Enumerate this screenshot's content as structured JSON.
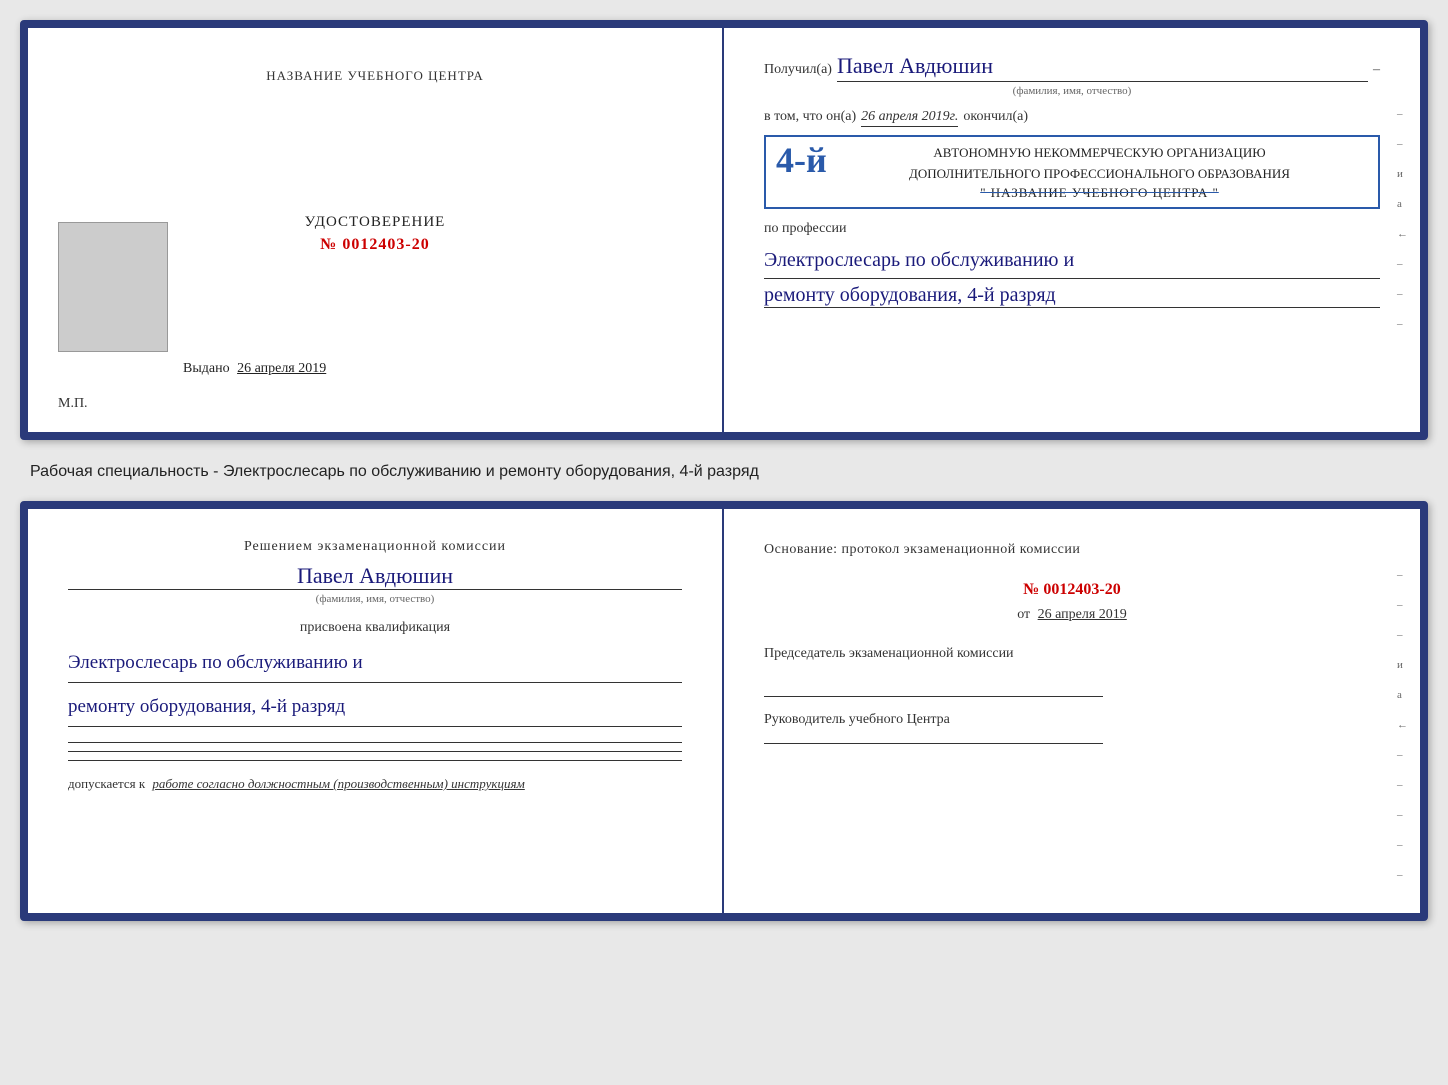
{
  "top_left": {
    "title": "НАЗВАНИЕ УЧЕБНОГО ЦЕНТРА",
    "udostoverenie_label": "УДОСТОВЕРЕНИЕ",
    "number": "№ 0012403-20",
    "vydano_label": "Выдано",
    "vydano_date": "26 апреля 2019",
    "mp_label": "М.П."
  },
  "top_right": {
    "poluchil_label": "Получил(а)",
    "name": "Павел Авдюшин",
    "name_hint": "(фамилия, имя, отчество)",
    "v_tom_label": "в том, что он(а)",
    "date": "26 апреля 2019г.",
    "okончil_label": "окончил(а)",
    "razryad_big": "4-й",
    "org_line1": "АВТОНОМНУЮ НЕКОММЕРЧЕСКУЮ ОРГАНИЗАЦИЮ",
    "org_line2": "ДОПОЛНИТЕЛЬНОГО ПРОФЕССИОНАЛЬНОГО ОБРАЗОВАНИЯ",
    "org_name": "\" НАЗВАНИЕ УЧЕБНОГО ЦЕНТРА \"",
    "po_professii_label": "по профессии",
    "profession_line1": "Электрослесарь по обслуживанию и",
    "profession_line2": "ремонту оборудования, 4-й разряд",
    "dash": "–"
  },
  "between_label": "Рабочая специальность - Электрослесарь по обслуживанию и ремонту оборудования, 4-й разряд",
  "bottom_left": {
    "resheniem_label": "Решением экзаменационной комиссии",
    "name": "Павел Авдюшин",
    "name_hint": "(фамилия, имя, отчество)",
    "prisvoena_label": "присвоена квалификация",
    "qualification_line1": "Электрослесарь по обслуживанию и",
    "qualification_line2": "ремонту оборудования, 4-й разряд",
    "dopuskaetsya_label": "допускается к",
    "dopuskaetsya_value": "работе согласно должностным (производственным) инструкциям"
  },
  "bottom_right": {
    "osnovanie_label": "Основание: протокол экзаменационной комиссии",
    "number": "№ 0012403-20",
    "ot_label": "от",
    "ot_date": "26 апреля 2019",
    "predsedatel_label": "Председатель экзаменационной комиссии",
    "rukovoditel_label": "Руководитель учебного Центра"
  },
  "side_dashes": [
    "-",
    "-",
    "и",
    "а",
    "←",
    "-",
    "-",
    "-"
  ],
  "side_dashes_bottom": [
    "-",
    "-",
    "-",
    "и",
    "а",
    "←",
    "-",
    "-",
    "-",
    "-",
    "-"
  ]
}
